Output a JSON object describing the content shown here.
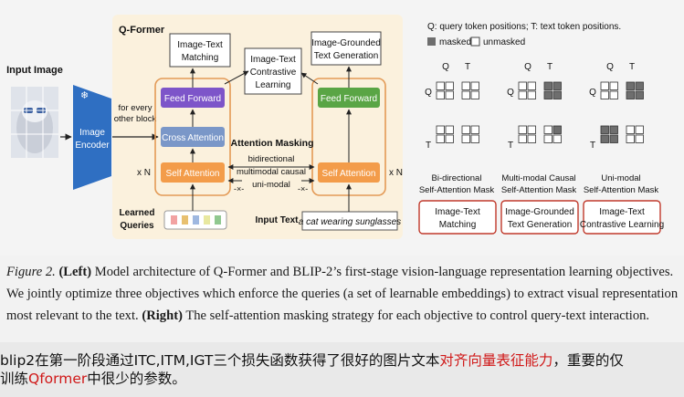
{
  "diagram": {
    "input_image_label": "Input Image",
    "image_encoder_label": [
      "Image",
      "Encoder"
    ],
    "qformer_title": "Q-Former",
    "itm_label": [
      "Image-Text",
      "Matching"
    ],
    "itc_label": [
      "Image-Text",
      "Contrastive",
      "Learning"
    ],
    "itg_label": [
      "Image-Grounded",
      "Text Generation"
    ],
    "feed_forward": "Feed Forward",
    "cross_attention": "Cross Attention",
    "self_attention": "Self Attention",
    "every_other_block": [
      "for every",
      "other block"
    ],
    "xn": "x N",
    "attention_masking": "Attention Masking",
    "mask_types": [
      "bidirectional",
      "multimodal causal",
      "uni-modal"
    ],
    "learned_queries": [
      "Learned",
      "Queries"
    ],
    "input_text_label": "Input Text",
    "input_text_value": "a cat wearing sunglasses",
    "legend_line": "Q: query token positions;   T: text token positions.",
    "legend_masked": "masked",
    "legend_unmasked": "unmasked",
    "grid_q": "Q",
    "grid_t": "T",
    "mask_grids": [
      {
        "title": [
          "Bi-directional",
          "Self-Attention Mask"
        ],
        "objective": [
          "Image-Text",
          "Matching"
        ],
        "masked_cells": []
      },
      {
        "title": [
          "Multi-modal Causal",
          "Self-Attention Mask"
        ],
        "objective": [
          "Image-Grounded",
          "Text Generation"
        ],
        "masked_cells": [
          [
            0,
            2
          ],
          [
            0,
            3
          ],
          [
            1,
            2
          ],
          [
            1,
            3
          ],
          [
            2,
            3
          ]
        ]
      },
      {
        "title": [
          "Uni-modal",
          "Self-Attention Mask"
        ],
        "objective": [
          "Image-Text",
          "Contrastive Learning"
        ],
        "masked_cells": [
          [
            0,
            2
          ],
          [
            0,
            3
          ],
          [
            1,
            2
          ],
          [
            1,
            3
          ],
          [
            2,
            0
          ],
          [
            2,
            1
          ],
          [
            3,
            0
          ],
          [
            3,
            1
          ]
        ]
      }
    ],
    "colors": {
      "qformer_bg": "#fbf1dd",
      "encoder_blue": "#2f6fc2",
      "feed_forward_purple": "#7d55c9",
      "cross_attention_blue": "#7a97c8",
      "self_attention_orange": "#f39c4a",
      "feed_forward_green": "#5aa545",
      "objective_box_border": "#c0392b",
      "masked_cell": "#6e6e6e"
    }
  },
  "caption": {
    "fig_label": "Figure 2.",
    "left_label": "(Left)",
    "text1": " Model architecture of Q-Former and BLIP-2’s first-stage vision-language representation learning objectives. We jointly optimize three objectives which enforce the queries (a set of learnable embeddings) to extract visual representation most relevant to the text. ",
    "right_label": "(Right)",
    "text2": " The self-attention masking strategy for each objective to control query-text interaction."
  },
  "subtitle": {
    "line1_a": "blip2在第一阶段通过ITC,ITM,IGT三个损失函数获得了很好的图片文本",
    "line1_red": "对齐向量表征能力",
    "line1_b": "，重要的仅",
    "line2_a": "训练",
    "line2_red": "Qformer",
    "line2_b": "中很少的参数。"
  }
}
